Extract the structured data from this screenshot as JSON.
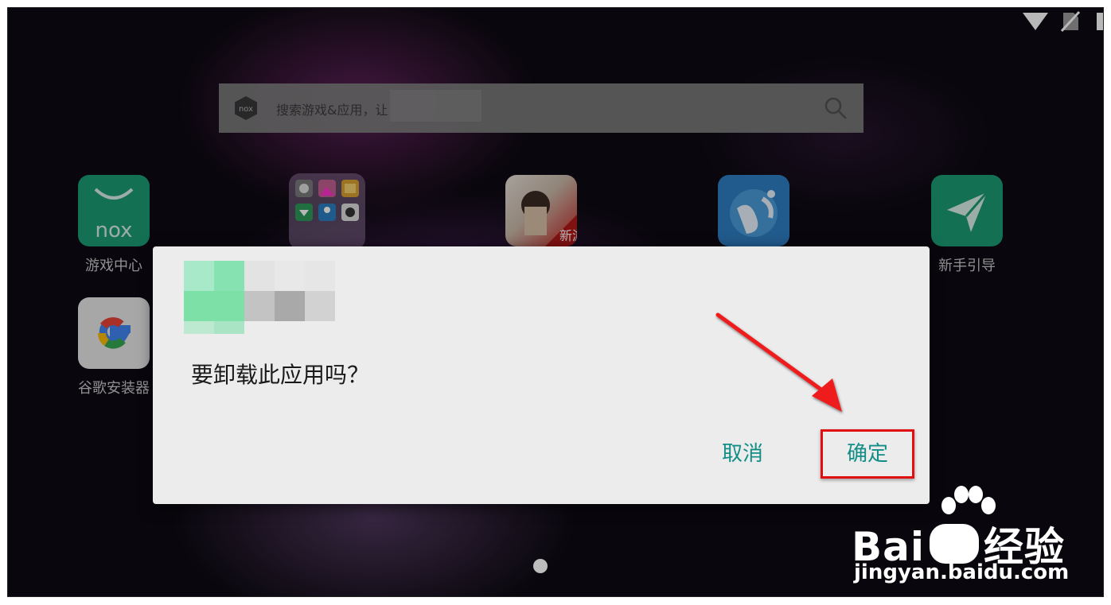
{
  "search": {
    "placeholder": "搜索游戏&应用，让"
  },
  "apps": [
    {
      "label": "游戏中心"
    },
    {
      "label": ""
    },
    {
      "label": ""
    },
    {
      "label": ""
    },
    {
      "label": "新手引导"
    },
    {
      "label": "谷歌安装器"
    }
  ],
  "dialog": {
    "question": "要卸载此应用吗？",
    "cancel_label": "取消",
    "confirm_label": "确定"
  },
  "watermark": {
    "brand_a": "Bai",
    "brand_b": "经验",
    "url": "jingyan.baidu.com"
  },
  "colors": {
    "accent": "#138e86",
    "highlight": "#e01010"
  }
}
